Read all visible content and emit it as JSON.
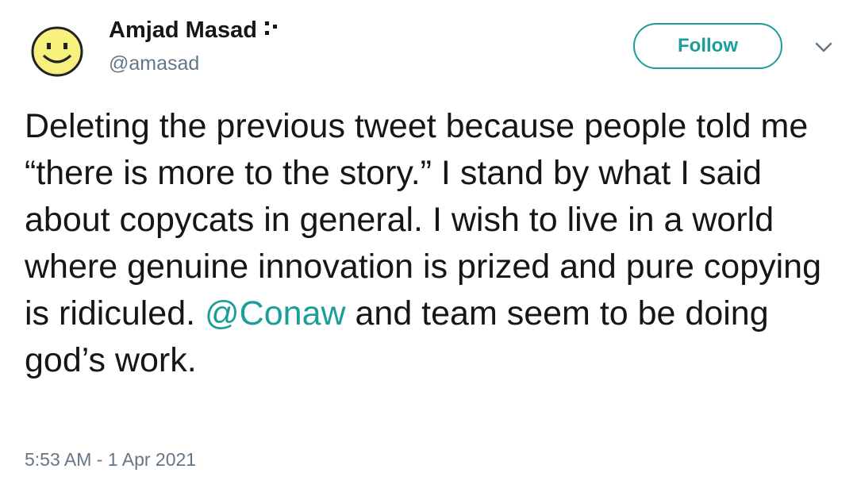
{
  "author": {
    "name": "Amjad Masad",
    "handle": "@amasad",
    "avatar_icon": "smiley-face-icon",
    "badge_icon": "dotted-glyph-icon"
  },
  "actions": {
    "follow_label": "Follow",
    "menu_icon": "chevron-down-icon"
  },
  "tweet": {
    "text_before": "Deleting the previous tweet because people told me “there is more to the story.” I stand by what I said about copycats in general. I wish to live in a world where genuine innovation is prized and pure copying is ridiculed. ",
    "mention": "@Conaw",
    "text_after": " and team seem to be doing god’s work.",
    "timestamp": "5:53 AM - 1 Apr 2021"
  },
  "colors": {
    "accent": "#1b9e9a",
    "text": "#14171a",
    "muted": "#657786",
    "avatar_fill": "#f7f07c"
  }
}
